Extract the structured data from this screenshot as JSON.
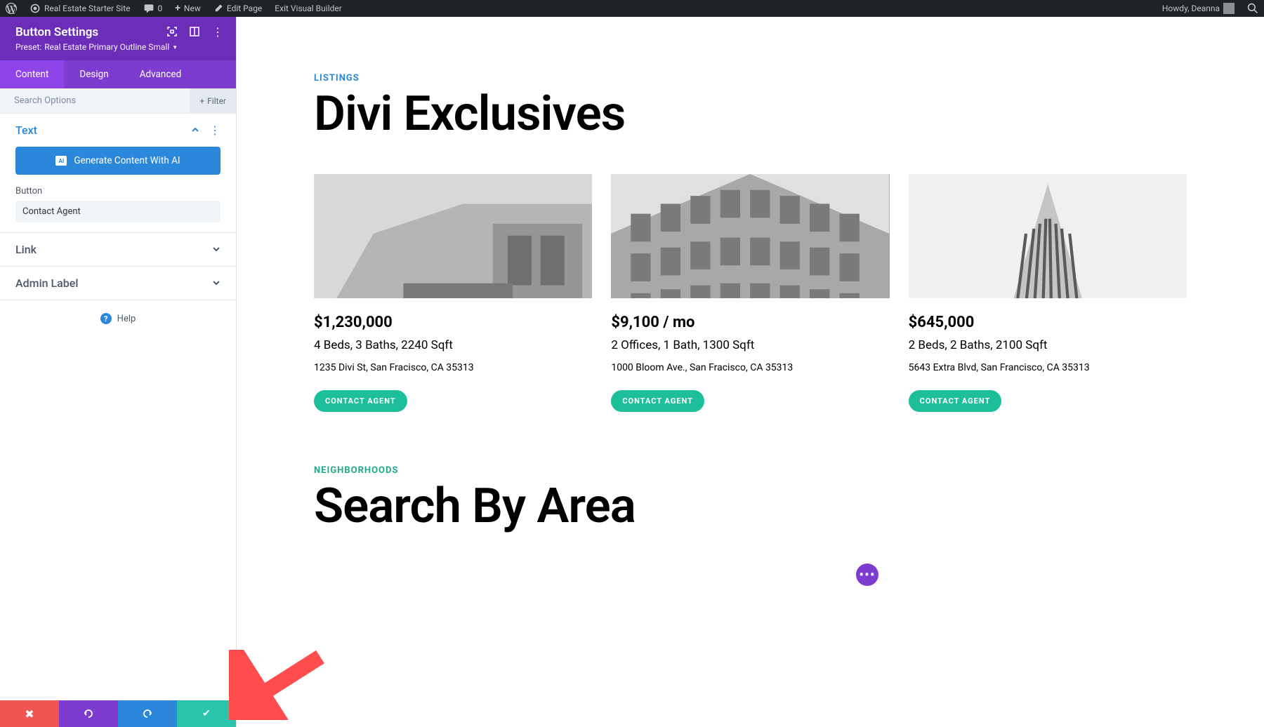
{
  "adminBar": {
    "siteName": "Real Estate Starter Site",
    "commentCount": "0",
    "newLabel": "New",
    "editPage": "Edit Page",
    "exitBuilder": "Exit Visual Builder",
    "greeting": "Howdy, Deanna"
  },
  "sidebar": {
    "title": "Button Settings",
    "presetPrefix": "Preset:",
    "presetName": "Real Estate Primary Outline Small",
    "tabs": [
      "Content",
      "Design",
      "Advanced"
    ],
    "searchPlaceholder": "Search Options",
    "filterLabel": "Filter",
    "sections": {
      "text": {
        "title": "Text",
        "aiLabel": "Generate Content With AI",
        "buttonFieldLabel": "Button",
        "buttonFieldValue": "Contact Agent"
      },
      "link": {
        "title": "Link"
      },
      "adminLabel": {
        "title": "Admin Label"
      }
    },
    "helpLabel": "Help"
  },
  "preview": {
    "listingsEyebrow": "LISTINGS",
    "listingsHeading": "Divi Exclusives",
    "listings": [
      {
        "price": "$1,230,000",
        "details": "4 Beds, 3 Baths, 2240 Sqft",
        "address": "1235 Divi St, San Fracisco, CA 35313",
        "cta": "CONTACT AGENT"
      },
      {
        "price": "$9,100 / mo",
        "details": "2 Offices, 1 Bath, 1300 Sqft",
        "address": "1000 Bloom Ave., San Fracisco, CA 35313",
        "cta": "CONTACT AGENT"
      },
      {
        "price": "$645,000",
        "details": "2 Beds, 2 Baths, 2100 Sqft",
        "address": "5643 Extra Blvd, San Francisco, CA 35313",
        "cta": "CONTACT AGENT"
      }
    ],
    "neighborhoodsEyebrow": "NEIGHBORHOODS",
    "neighborhoodsHeading": "Search By Area"
  }
}
